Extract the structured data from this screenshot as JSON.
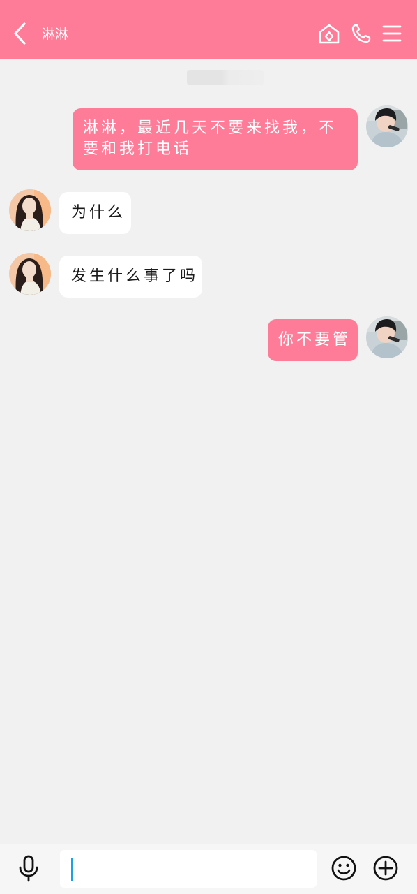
{
  "header": {
    "title": "淋淋",
    "back_icon": "chevron-left-icon",
    "actions": [
      "home-icon",
      "phone-icon",
      "menu-icon"
    ],
    "background": "#fe7c98"
  },
  "timestamp": {
    "text": ""
  },
  "messages": [
    {
      "side": "right",
      "text": "淋淋，最近几天不要来找我，不要和我打电话"
    },
    {
      "side": "left",
      "text": "为什么"
    },
    {
      "side": "left",
      "text": "发生什么事了吗"
    },
    {
      "side": "right",
      "text": "你不要管"
    }
  ],
  "composer": {
    "value": "",
    "icons": [
      "microphone-icon",
      "emoji-icon",
      "plus-icon"
    ]
  },
  "colors": {
    "accent": "#fe7c98",
    "background": "#f1f1f1",
    "incoming_bubble": "#ffffff",
    "caret": "#1ea0e8"
  }
}
